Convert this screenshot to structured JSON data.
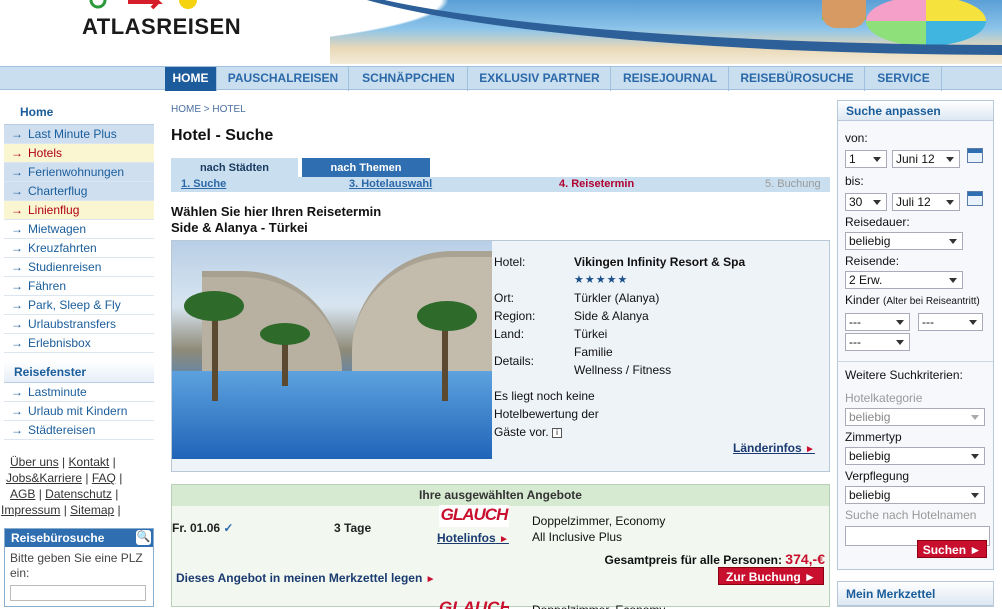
{
  "brand": {
    "name": "ATLASREISEN"
  },
  "mainnav": [
    {
      "label": "HOME"
    },
    {
      "label": "PAUSCHALREISEN"
    },
    {
      "label": "SCHNÄPPCHEN"
    },
    {
      "label": "EXKLUSIV PARTNER"
    },
    {
      "label": "REISEJOURNAL"
    },
    {
      "label": "REISEBÜROSUCHE"
    },
    {
      "label": "SERVICE"
    }
  ],
  "leftnav": {
    "home": "Home",
    "items": [
      {
        "label": "Last Minute Plus"
      },
      {
        "label": "Hotels"
      },
      {
        "label": "Ferienwohnungen"
      },
      {
        "label": "Charterflug"
      },
      {
        "label": "Linienflug"
      },
      {
        "label": "Mietwagen"
      },
      {
        "label": "Kreuzfahrten"
      },
      {
        "label": "Studienreisen"
      },
      {
        "label": "Fähren"
      },
      {
        "label": "Park, Sleep & Fly"
      },
      {
        "label": "Urlaubstransfers"
      },
      {
        "label": "Erlebnisbox"
      }
    ],
    "section": "Reisefenster",
    "section_items": [
      {
        "label": "Lastminute"
      },
      {
        "label": "Urlaub mit Kindern"
      },
      {
        "label": "Städtereisen"
      }
    ],
    "footer": {
      "ueber": "Über uns",
      "kontakt": "Kontakt",
      "jobs": "Jobs&Karriere",
      "faq": "FAQ",
      "agb": "AGB",
      "datenschutz": "Datenschutz",
      "impressum": "Impressum",
      "sitemap": "Sitemap",
      "sep": "|"
    },
    "reisebuero": {
      "title": "Reisebürosuche",
      "text": "Bitte geben Sie eine PLZ ein:"
    }
  },
  "center": {
    "breadcrumb": "HOME > HOTEL",
    "title": "Hotel - Suche",
    "tabs": [
      "nach Städten",
      "nach Themen"
    ],
    "steps": [
      "1. Suche",
      "3. Hotelauswahl",
      "4. Reisetermin",
      "5. Buchung"
    ],
    "headline1": "Wählen Sie hier Ihren Reisetermin",
    "headline2": "Side & Alanya - Türkei",
    "hotel": {
      "k_hotel": "Hotel:",
      "name": "Vikingen Infinity Resort & Spa",
      "stars": "★★★★★",
      "k_ort": "Ort:",
      "ort": "Türkler (Alanya)",
      "k_region": "Region:",
      "region": "Side & Alanya",
      "k_land": "Land:",
      "land": "Türkei",
      "k_details": "Details:",
      "details1": "Familie",
      "details2": "Wellness / Fitness",
      "no_rating": "Es liegt noch keine Hotelbewertung der Gäste vor.",
      "info_icon": "i",
      "laender": "Länderinfos"
    },
    "offers": {
      "head": "Ihre ausgewählten Angebote",
      "date": "Fr. 01.06",
      "days": "3 Tage",
      "operator": "GLAUCH",
      "hotelinfos": "Hotelinfos",
      "room": "Doppelzimmer, Economy",
      "board": "All Inclusive Plus",
      "total_label": "Gesamtpreis für alle Personen:",
      "price": "374,-€",
      "merkzettel": "Dieses Angebot in meinen Merkzettel legen",
      "book": "Zur Buchung",
      "operator2": "GLAUCH",
      "room2": "Doppelzimmer, Economy"
    }
  },
  "right": {
    "title": "Suche anpassen",
    "von": "von:",
    "von_day": "1",
    "von_month": "Juni 12",
    "bis": "bis:",
    "bis_day": "30",
    "bis_month": "Juli 12",
    "dauer": "Reisedauer:",
    "dauer_val": "beliebig",
    "reisende": "Reisende:",
    "reisende_val": "2 Erw.",
    "kinder": "Kinder",
    "kinder_note": "(Alter bei Reiseantritt)",
    "kinder_val": "---",
    "weitere": "Weitere Suchkriterien:",
    "kategorie": "Hotelkategorie",
    "kategorie_val": "beliebig",
    "zimmer": "Zimmertyp",
    "zimmer_val": "beliebig",
    "verpflegung": "Verpflegung",
    "verpflegung_val": "beliebig",
    "hotelname": "Suche nach Hotelnamen",
    "search": "Suchen",
    "merkzettel": "Mein Merkzettel"
  },
  "colors": {
    "nav_active": "#1c5c9c",
    "accent_red": "#c8102e",
    "link_blue": "#1a5d9a"
  }
}
